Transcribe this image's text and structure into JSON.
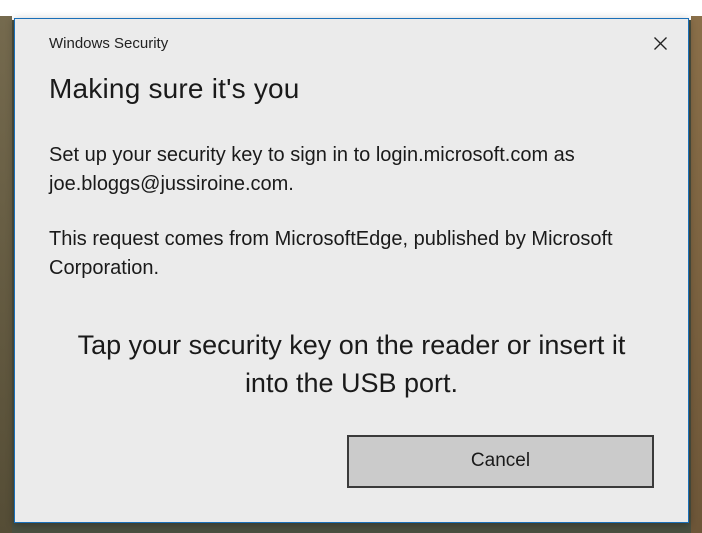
{
  "dialog": {
    "title": "Windows Security",
    "heading": "Making sure it's you",
    "description": "Set up your security key to sign in to login.microsoft.com as joe.bloggs@jussiroine.com.",
    "publisher": "This request comes from MicrosoftEdge, published by Microsoft Corporation.",
    "instruction": "Tap your security key on the reader or insert it into the USB port.",
    "cancel_label": "Cancel"
  }
}
